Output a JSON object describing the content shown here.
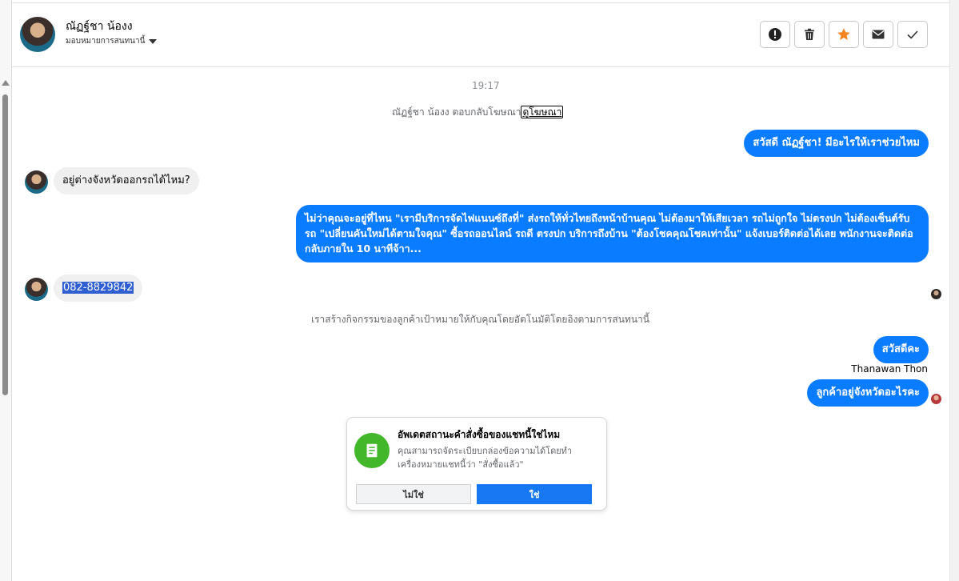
{
  "header": {
    "contact_name": "ณัฏฐ์ชา น้องง",
    "assign_label": "มอบหมายการสนทนานี้",
    "actions": [
      "alert-icon",
      "trash-icon",
      "star-icon",
      "mail-icon",
      "check-icon"
    ],
    "star_color": "#f5831f"
  },
  "conversation": {
    "timestamp": "19:17",
    "replied_prefix": "ณัฏฐ์ชา น้องง ตอบกลับโฆษณา",
    "replied_link": "ดูโฆษณา",
    "messages": [
      {
        "from": "page",
        "text": "สวัสดี ณัฏฐ์ชา! มีอะไรให้เราช่วยไหม"
      },
      {
        "from": "customer",
        "text": "อยู่ต่างจังหวัดออกรถได้ไหม?"
      },
      {
        "from": "page",
        "text": "ไม่ว่าคุณจะอยู่ที่ไหน \"เรามีบริการจัดไฟแนนซ์ถึงที่\"  ส่งรถให้ทั่วไทยถึงหน้าบ้านคุณ ไม่ต้องมาให้เสียเวลา รถไม่ถูกใจ ไม่ตรงปก ไม่ต้องเซ็นต์รับรถ \"เปลี่ยนคันใหม่ได้ตามใจคุณ\" ซื้อรถออนไลน์ รถดี ตรงปก บริการถึงบ้าน \"ต้องโชคคุณโชคเท่านั้น\" แจ้งเบอร์ติดต่อได้เลย พนักงานจะติดต่อกลับภายใน 10 นาทีจ้าา..."
      },
      {
        "from": "customer",
        "text": "082-8829842"
      },
      {
        "from": "page",
        "text": "สวัสดีคะ"
      },
      {
        "from": "page",
        "text": "ลูกค้าอยู่จังหวัดอะไรคะ"
      }
    ],
    "system_note": "เราสร้างกิจกรรมของลูกค้าเป้าหมายให้กับคุณโดยอัตโนมัติโดยอิงตามการสนทนานี้",
    "sender_name": "Thanawan Thon",
    "outgoing_color": "#0a7cff"
  },
  "prompt_card": {
    "title": "อัพเดตสถานะคำสั่งซื้อของแชทนี้ใช่ไหม",
    "description": "คุณสามารถจัดระเบียบกล่องข้อความได้โดยทำเครื่องหมายแชทนี้ว่า \"สั่งซื้อแล้ว\"",
    "no_label": "ไม่ใช่",
    "yes_label": "ใช่",
    "icon": "order-icon",
    "icon_color": "#42b72a"
  }
}
